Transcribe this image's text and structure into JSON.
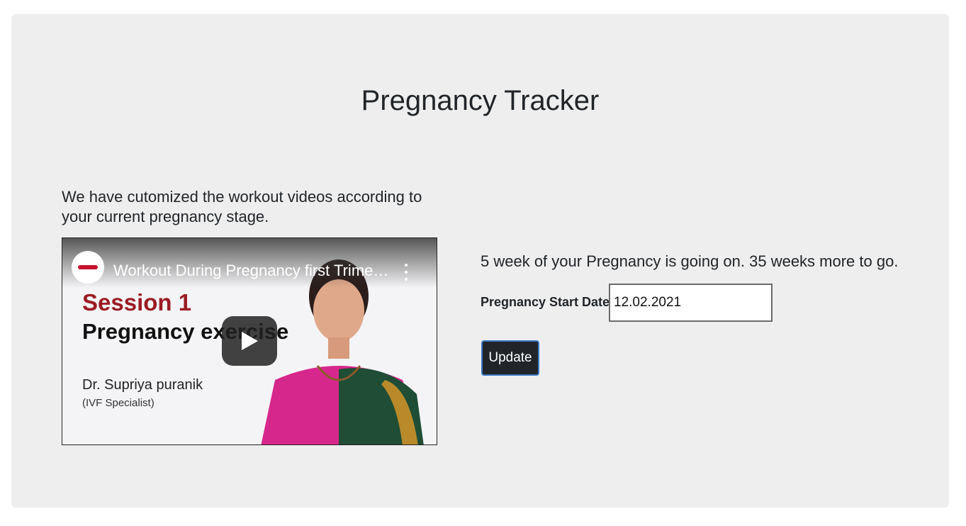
{
  "page": {
    "title": "Pregnancy Tracker"
  },
  "workout": {
    "intro": "We have cutomized the workout videos according to your current pregnancy stage.",
    "video": {
      "title": "Workout During Pregnancy first Trimest...",
      "session_label": "Session 1",
      "session_subtitle": "Pregnancy exercise",
      "doctor_name": "Dr. Supriya puranik",
      "doctor_role": "(IVF Specialist)",
      "icons": [
        "channel-logo-icon",
        "more-vert-icon",
        "play-icon"
      ]
    }
  },
  "tracker": {
    "status": "5 week of your Pregnancy is going on. 35 weeks more to go.",
    "start_date_label": "Pregnancy Start Date",
    "start_date_value": "12.02.2021",
    "update_label": "Update"
  },
  "colors": {
    "card_background": "#eeeeee",
    "button_background": "#212529",
    "button_border": "#3b79c3",
    "session_accent": "#9b1c24"
  }
}
